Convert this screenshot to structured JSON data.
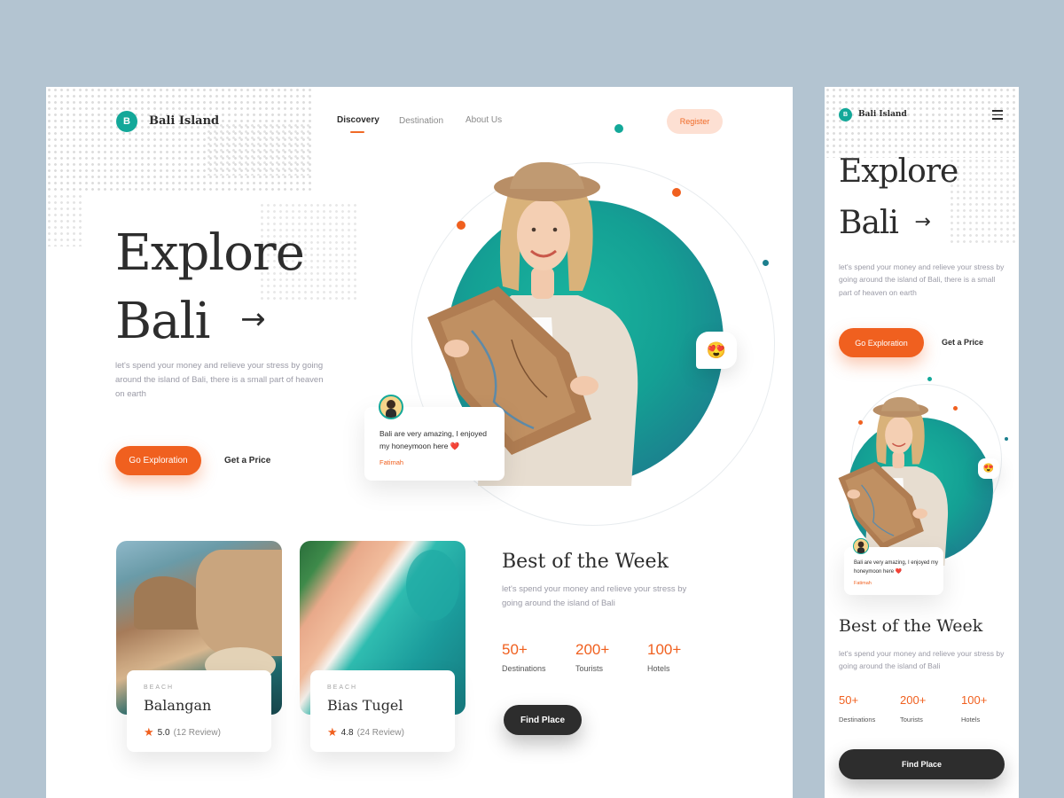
{
  "brand": {
    "initial": "B",
    "name": "Bali Island"
  },
  "nav": {
    "items": [
      {
        "label": "Discovery",
        "active": true
      },
      {
        "label": "Destination",
        "active": false
      },
      {
        "label": "About Us",
        "active": false
      }
    ],
    "register_label": "Register"
  },
  "hero": {
    "title_line1": "Explore",
    "title_line2": "Bali",
    "arrow": "→",
    "description": "let's spend your money and relieve your stress by going around the island of Bali, there is a small part of heaven on earth",
    "primary_cta": "Go Exploration",
    "secondary_cta": "Get a Price",
    "emoji": "😍"
  },
  "review": {
    "text": "Bali are very amazing, I enjoyed my honeymoon here",
    "heart": "❤️",
    "author": "Fatimah"
  },
  "destinations": [
    {
      "tag": "BEACH",
      "name": "Balangan",
      "rating": "5.0",
      "reviews": "(12 Review)"
    },
    {
      "tag": "BEACH",
      "name": "Bias Tugel",
      "rating": "4.8",
      "reviews": "(24 Review)"
    }
  ],
  "best_week": {
    "title": "Best of the Week",
    "description": "let's spend your money and relieve your stress by going around the island of Bali",
    "stats": [
      {
        "value": "50+",
        "label": "Destinations"
      },
      {
        "value": "200+",
        "label": "Tourists"
      },
      {
        "value": "100+",
        "label": "Hotels"
      }
    ],
    "cta": "Find Place"
  },
  "colors": {
    "accent": "#f0601f",
    "teal": "#13a899",
    "dark": "#2d2d2d",
    "background": "#b3c4d1"
  },
  "icons": {
    "star": "★",
    "menu": "menu-icon"
  }
}
